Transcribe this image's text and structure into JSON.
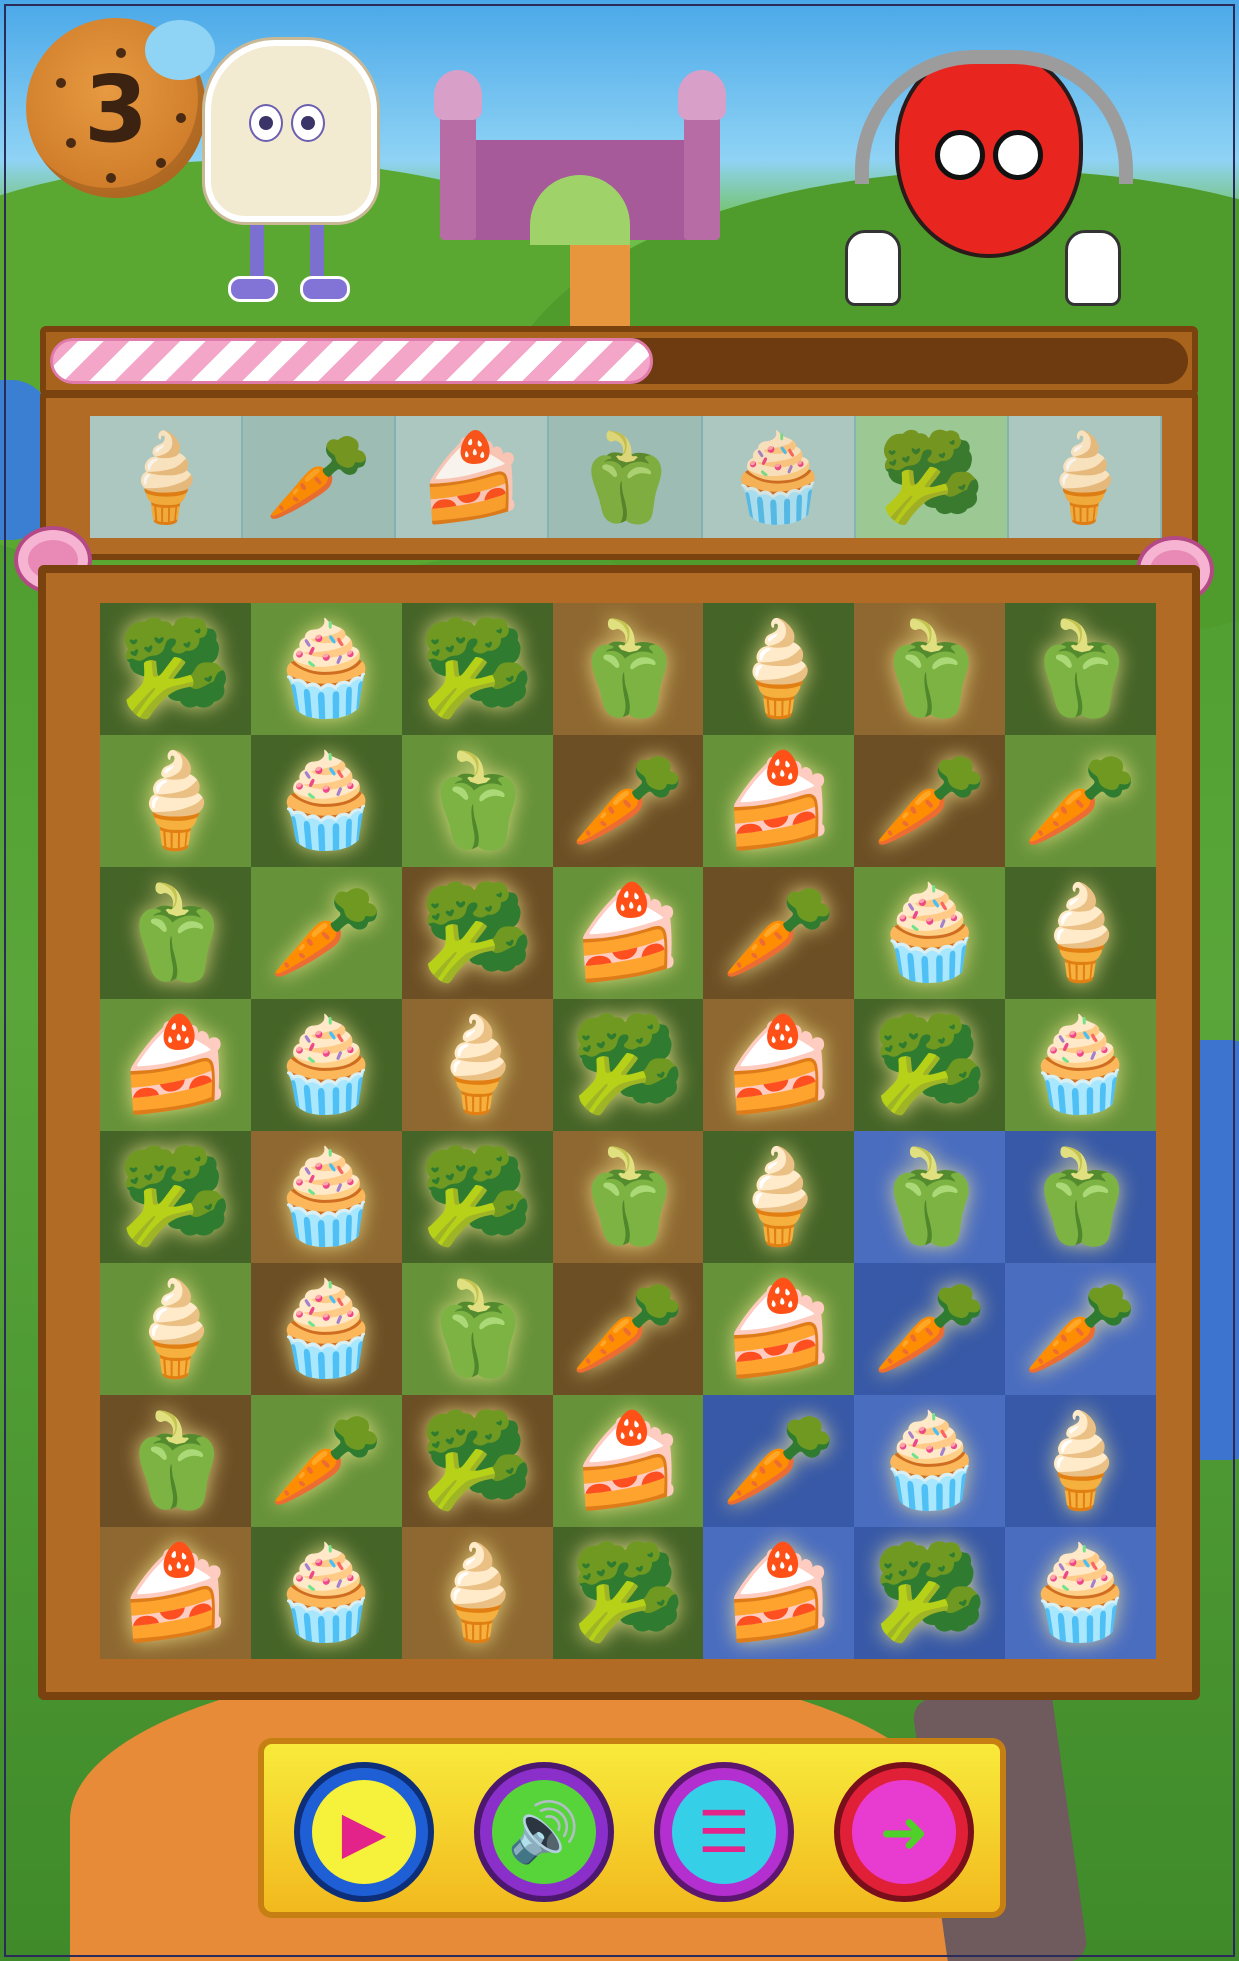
{
  "hud": {
    "level": "3",
    "progress_fraction": 0.53
  },
  "goal_strip": {
    "items": [
      {
        "icon": "ice-cream-icon",
        "glyph": "🍦"
      },
      {
        "icon": "carrot-icon",
        "glyph": "🥕"
      },
      {
        "icon": "cake-slice-icon",
        "glyph": "🍰"
      },
      {
        "icon": "bell-pepper-icon",
        "glyph": "🫑"
      },
      {
        "icon": "cupcake-icon",
        "glyph": "🧁"
      },
      {
        "icon": "broccoli-icon",
        "glyph": "🥦"
      },
      {
        "icon": "ice-cream-icon",
        "glyph": "🍦"
      }
    ],
    "current_index": 5
  },
  "pieces": {
    "B": {
      "icon": "broccoli-icon",
      "glyph": "🥦"
    },
    "M": {
      "icon": "cupcake-icon",
      "glyph": "🧁"
    },
    "P": {
      "icon": "bell-pepper-icon",
      "glyph": "🫑"
    },
    "I": {
      "icon": "ice-cream-icon",
      "glyph": "🍦"
    },
    "C": {
      "icon": "carrot-icon",
      "glyph": "🥕"
    },
    "K": {
      "icon": "cake-slice-icon",
      "glyph": "🍰"
    }
  },
  "board": {
    "rows": [
      [
        "B",
        "M",
        "B",
        "P",
        "I",
        "P",
        "P"
      ],
      [
        "I",
        "M",
        "P",
        "C",
        "K",
        "C",
        "C"
      ],
      [
        "P",
        "C",
        "B",
        "K",
        "C",
        "M",
        "I"
      ],
      [
        "K",
        "M",
        "I",
        "B",
        "K",
        "B",
        "M"
      ],
      [
        "B",
        "M",
        "B",
        "P",
        "I",
        "P",
        "P"
      ],
      [
        "I",
        "M",
        "P",
        "C",
        "K",
        "C",
        "C"
      ],
      [
        "P",
        "C",
        "B",
        "K",
        "C",
        "M",
        "I"
      ],
      [
        "K",
        "M",
        "I",
        "B",
        "K",
        "B",
        "M"
      ]
    ]
  },
  "controls": {
    "play_icon": "play-icon",
    "sound_icon": "sound-icon",
    "menu_icon": "menu-list-icon",
    "next_icon": "arrow-right-icon"
  }
}
